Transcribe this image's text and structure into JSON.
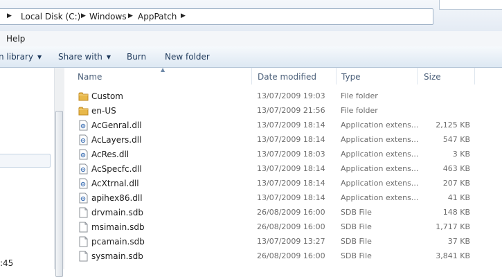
{
  "address": {
    "crumbs": [
      "Local Disk (C:)",
      "Windows",
      "AppPatch"
    ]
  },
  "menu": {
    "help": "Help"
  },
  "commands": {
    "library": "n library",
    "share": "Share with",
    "burn": "Burn",
    "new_folder": "New folder"
  },
  "columns": {
    "name": "Name",
    "date": "Date modified",
    "type": "Type",
    "size": "Size"
  },
  "nav": {
    "bottom_text": ":45"
  },
  "files": [
    {
      "name": "Custom",
      "date": "13/07/2009 19:03",
      "type": "File folder",
      "size": "",
      "icon": "folder-icon"
    },
    {
      "name": "en-US",
      "date": "13/07/2009 21:56",
      "type": "File folder",
      "size": "",
      "icon": "folder-icon"
    },
    {
      "name": "AcGenral.dll",
      "date": "13/07/2009 18:14",
      "type": "Application extens...",
      "size": "2,125 KB",
      "icon": "dll-icon"
    },
    {
      "name": "AcLayers.dll",
      "date": "13/07/2009 18:14",
      "type": "Application extens...",
      "size": "547 KB",
      "icon": "dll-icon"
    },
    {
      "name": "AcRes.dll",
      "date": "13/07/2009 18:03",
      "type": "Application extens...",
      "size": "3 KB",
      "icon": "dll-icon"
    },
    {
      "name": "AcSpecfc.dll",
      "date": "13/07/2009 18:14",
      "type": "Application extens...",
      "size": "463 KB",
      "icon": "dll-icon"
    },
    {
      "name": "AcXtrnal.dll",
      "date": "13/07/2009 18:14",
      "type": "Application extens...",
      "size": "207 KB",
      "icon": "dll-icon"
    },
    {
      "name": "apihex86.dll",
      "date": "13/07/2009 18:14",
      "type": "Application extens...",
      "size": "41 KB",
      "icon": "dll-icon"
    },
    {
      "name": "drvmain.sdb",
      "date": "26/08/2009 16:00",
      "type": "SDB File",
      "size": "148 KB",
      "icon": "sdb-file-icon"
    },
    {
      "name": "msimain.sdb",
      "date": "26/08/2009 16:00",
      "type": "SDB File",
      "size": "1,717 KB",
      "icon": "sdb-file-icon"
    },
    {
      "name": "pcamain.sdb",
      "date": "13/07/2009 13:27",
      "type": "SDB File",
      "size": "37 KB",
      "icon": "sdb-file-icon"
    },
    {
      "name": "sysmain.sdb",
      "date": "26/08/2009 16:00",
      "type": "SDB File",
      "size": "3,841 KB",
      "icon": "sdb-file-icon"
    }
  ],
  "colors": {
    "folder": "#e8b84a",
    "command_text": "#1e395b",
    "header_text": "#4c607a"
  }
}
